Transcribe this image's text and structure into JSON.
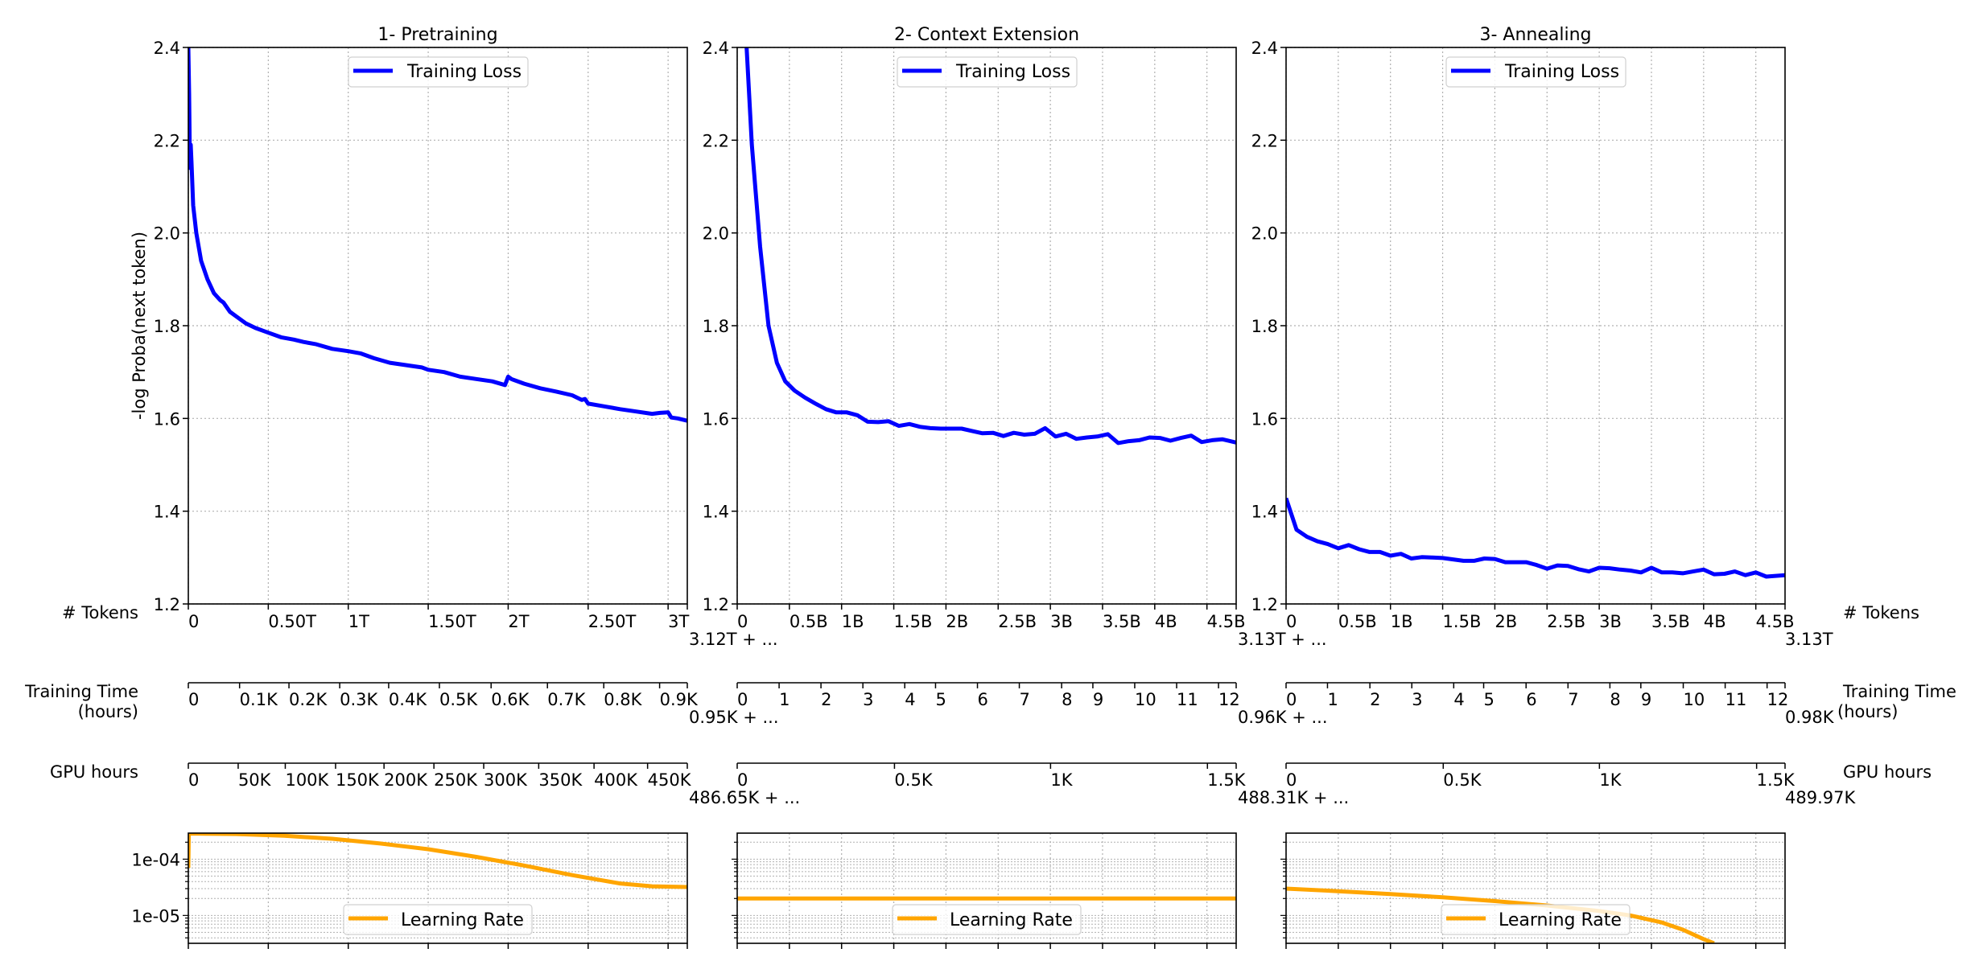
{
  "figure": {
    "row_labels_left": {
      "tokens": "# Tokens",
      "training_time_line1": "Training Time",
      "training_time_line2": "(hours)",
      "gpu_hours": "GPU hours"
    },
    "row_labels_right": {
      "tokens": "# Tokens",
      "training_time_line1": "Training Time",
      "training_time_line2": "(hours)",
      "gpu_hours": "GPU hours"
    },
    "colors": {
      "loss": "#0000ff",
      "lr": "#ffa500",
      "grid": "#b0b0b0"
    }
  },
  "chart_data": [
    {
      "type": "line",
      "panel": 1,
      "title": "1- Pretraining",
      "ylabel": "-log Proba(next token)",
      "ylim": [
        1.2,
        2.4
      ],
      "yticks": [
        1.2,
        1.4,
        1.6,
        1.8,
        2.0,
        2.2,
        2.4
      ],
      "ytick_labels": [
        "1.2",
        "1.4",
        "1.6",
        "1.8",
        "2.0",
        "2.2",
        "2.4"
      ],
      "grid": true,
      "legend": {
        "label": "Training Loss",
        "position": "upper-center"
      },
      "x_unit": "T tokens",
      "xlim": [
        0,
        3.12
      ],
      "series": [
        {
          "name": "Training Loss",
          "x": [
            0,
            0.005,
            0.01,
            0.015,
            0.02,
            0.03,
            0.05,
            0.08,
            0.12,
            0.16,
            0.2,
            0.22,
            0.26,
            0.3,
            0.36,
            0.42,
            0.5,
            0.58,
            0.66,
            0.72,
            0.8,
            0.9,
            1.0,
            1.08,
            1.16,
            1.26,
            1.36,
            1.46,
            1.5,
            1.6,
            1.7,
            1.8,
            1.9,
            1.98,
            2.0,
            2.02,
            2.1,
            2.2,
            2.3,
            2.4,
            2.46,
            2.48,
            2.5,
            2.6,
            2.7,
            2.8,
            2.9,
            2.95,
            3.0,
            3.02,
            3.06,
            3.12
          ],
          "y": [
            2.4,
            2.3,
            2.14,
            2.19,
            2.15,
            2.06,
            2.0,
            1.94,
            1.9,
            1.87,
            1.855,
            1.85,
            1.83,
            1.82,
            1.805,
            1.795,
            1.785,
            1.775,
            1.77,
            1.765,
            1.76,
            1.75,
            1.745,
            1.74,
            1.73,
            1.72,
            1.715,
            1.71,
            1.705,
            1.7,
            1.69,
            1.685,
            1.68,
            1.672,
            1.69,
            1.685,
            1.675,
            1.665,
            1.658,
            1.65,
            1.64,
            1.642,
            1.632,
            1.626,
            1.62,
            1.615,
            1.61,
            1.612,
            1.613,
            1.602,
            1.6,
            1.595
          ]
        }
      ],
      "x_axes": {
        "tokens": {
          "ticks": [
            0,
            0.5,
            1,
            1.5,
            2,
            2.5,
            3
          ],
          "labels": [
            "0",
            "0.50T",
            "1T",
            "1.50T",
            "2T",
            "2.50T",
            "3T"
          ],
          "offset": ""
        },
        "training_time": {
          "at": [
            0,
            0.1027,
            0.2017,
            0.3034,
            0.4015,
            0.5032,
            0.6068,
            0.7197,
            0.8326,
            0.9445
          ],
          "labels": [
            "0",
            "0.1K",
            "0.2K",
            "0.3K",
            "0.4K",
            "0.5K",
            "0.6K",
            "0.7K",
            "0.8K",
            "0.9K"
          ],
          "offset": ""
        },
        "gpu_hours": {
          "at": [
            0,
            0.0999,
            0.1943,
            0.2951,
            0.3922,
            0.4922,
            0.592,
            0.7022,
            0.8131,
            0.9204
          ],
          "labels": [
            "0",
            "50K",
            "100K",
            "150K",
            "200K",
            "250K",
            "300K",
            "350K",
            "400K",
            "450K"
          ],
          "offset": ""
        }
      },
      "lr": {
        "legend": "Learning Rate",
        "yscale": "log",
        "ylim": [
          3.2e-06,
          0.00029
        ],
        "ytick_labels": [
          "1e-05",
          "1e-04"
        ],
        "yticks": [
          1e-05,
          0.0001
        ],
        "x": [
          0,
          0.003,
          0.006,
          0.3,
          0.6,
          0.9,
          1.2,
          1.5,
          1.8,
          2.1,
          2.4,
          2.7,
          2.9,
          3.12
        ],
        "y": [
          7e-05,
          0.00028,
          0.000285,
          0.00028,
          0.00026,
          0.00023,
          0.00019,
          0.00015,
          0.00011,
          7.7e-05,
          5.2e-05,
          3.7e-05,
          3.3e-05,
          3.2e-05
        ]
      }
    },
    {
      "type": "line",
      "panel": 2,
      "title": "2- Context Extension",
      "ylim": [
        1.2,
        2.4
      ],
      "yticks": [
        1.2,
        1.4,
        1.6,
        1.8,
        2.0,
        2.2,
        2.4
      ],
      "ytick_labels": [
        "1.2",
        "1.4",
        "1.6",
        "1.8",
        "2.0",
        "2.2",
        "2.4"
      ],
      "grid": true,
      "legend": {
        "label": "Training Loss",
        "position": "upper-center"
      },
      "x_unit": "B tokens",
      "xlim": [
        0,
        4.78
      ],
      "series": [
        {
          "name": "Training Loss",
          "x": [
            0.09,
            0.14,
            0.22,
            0.3,
            0.38,
            0.46,
            0.55,
            0.65,
            0.75,
            0.85,
            0.95,
            1.05,
            1.15,
            1.25,
            1.35,
            1.45,
            1.55,
            1.65,
            1.75,
            1.85,
            1.95,
            2.05,
            2.15,
            2.25,
            2.35,
            2.45,
            2.55,
            2.65,
            2.75,
            2.85,
            2.95,
            3.05,
            3.15,
            3.25,
            3.35,
            3.45,
            3.55,
            3.65,
            3.75,
            3.85,
            3.95,
            4.05,
            4.15,
            4.25,
            4.35,
            4.45,
            4.55,
            4.65,
            4.78
          ],
          "y": [
            2.4,
            2.19,
            1.97,
            1.8,
            1.72,
            1.68,
            1.66,
            1.645,
            1.632,
            1.62,
            1.613,
            1.613,
            1.607,
            1.593,
            1.592,
            1.594,
            1.584,
            1.588,
            1.582,
            1.579,
            1.578,
            1.578,
            1.578,
            1.573,
            1.568,
            1.569,
            1.562,
            1.569,
            1.565,
            1.567,
            1.579,
            1.561,
            1.567,
            1.556,
            1.559,
            1.561,
            1.566,
            1.547,
            1.551,
            1.553,
            1.559,
            1.558,
            1.552,
            1.558,
            1.563,
            1.549,
            1.553,
            1.555,
            1.548
          ]
        }
      ],
      "x_axes": {
        "tokens": {
          "ticks": [
            0,
            0.5,
            1,
            1.5,
            2,
            2.5,
            3,
            3.5,
            4,
            4.5
          ],
          "labels": [
            "0",
            "0.5B",
            "1B",
            "1.5B",
            "2B",
            "2.5B",
            "3B",
            "3.5B",
            "4B",
            "4.5B"
          ],
          "offset": "3.12T + ..."
        },
        "training_time": {
          "at": [
            0,
            0.084,
            0.1679,
            0.2519,
            0.3358,
            0.3975,
            0.4815,
            0.5654,
            0.6502,
            0.7128,
            0.7967,
            0.8807,
            0.9646
          ],
          "labels": [
            "0",
            "1",
            "2",
            "3",
            "4",
            "5",
            "6",
            "7",
            "8",
            "9",
            "10",
            "11",
            "12"
          ],
          "offset": "0.95K + ..."
        },
        "gpu_hours": {
          "at": [
            0,
            0.3152,
            0.628,
            0.9424
          ],
          "labels": [
            "0",
            "0.5K",
            "1K",
            "1.5K"
          ],
          "offset": "486.65K + ..."
        }
      },
      "lr": {
        "legend": "Learning Rate",
        "yscale": "log",
        "ylim": [
          3.2e-06,
          0.00029
        ],
        "x": [
          0,
          4.78
        ],
        "y": [
          2e-05,
          2e-05
        ]
      }
    },
    {
      "type": "line",
      "panel": 3,
      "title": "3- Annealing",
      "ylim": [
        1.2,
        2.4
      ],
      "yticks": [
        1.2,
        1.4,
        1.6,
        1.8,
        2.0,
        2.2,
        2.4
      ],
      "ytick_labels": [
        "1.2",
        "1.4",
        "1.6",
        "1.8",
        "2.0",
        "2.2",
        "2.4"
      ],
      "grid": true,
      "legend": {
        "label": "Training Loss",
        "position": "upper-center"
      },
      "x_unit": "B tokens",
      "xlim": [
        0,
        4.78
      ],
      "series": [
        {
          "name": "Training Loss",
          "x": [
            0,
            0.1,
            0.2,
            0.3,
            0.4,
            0.5,
            0.6,
            0.7,
            0.8,
            0.9,
            1.0,
            1.1,
            1.2,
            1.3,
            1.4,
            1.5,
            1.6,
            1.7,
            1.8,
            1.9,
            2.0,
            2.1,
            2.2,
            2.3,
            2.4,
            2.5,
            2.6,
            2.7,
            2.8,
            2.9,
            3.0,
            3.1,
            3.2,
            3.3,
            3.4,
            3.5,
            3.6,
            3.7,
            3.8,
            3.9,
            4.0,
            4.1,
            4.2,
            4.3,
            4.4,
            4.5,
            4.6,
            4.78
          ],
          "y": [
            1.428,
            1.36,
            1.345,
            1.335,
            1.329,
            1.32,
            1.327,
            1.318,
            1.312,
            1.312,
            1.304,
            1.308,
            1.298,
            1.301,
            1.3,
            1.299,
            1.296,
            1.293,
            1.293,
            1.298,
            1.297,
            1.29,
            1.29,
            1.29,
            1.284,
            1.276,
            1.283,
            1.282,
            1.275,
            1.27,
            1.278,
            1.277,
            1.274,
            1.272,
            1.268,
            1.278,
            1.268,
            1.268,
            1.266,
            1.27,
            1.274,
            1.264,
            1.265,
            1.27,
            1.262,
            1.268,
            1.259,
            1.262
          ]
        }
      ],
      "x_axes": {
        "tokens": {
          "ticks": [
            0,
            0.5,
            1,
            1.5,
            2,
            2.5,
            3,
            3.5,
            4,
            4.5
          ],
          "labels": [
            "0",
            "0.5B",
            "1B",
            "1.5B",
            "2B",
            "2.5B",
            "3B",
            "3.5B",
            "4B",
            "4.5B"
          ],
          "offset": "3.13T + ...",
          "end_label": "3.13T"
        },
        "training_time": {
          "at": [
            0,
            0.083,
            0.168,
            0.252,
            0.336,
            0.396,
            0.481,
            0.565,
            0.649,
            0.711,
            0.796,
            0.88,
            0.964
          ],
          "labels": [
            "0",
            "1",
            "2",
            "3",
            "4",
            "5",
            "6",
            "7",
            "8",
            "9",
            "10",
            "11",
            "12"
          ],
          "offset": "0.96K + ...",
          "end_label": "0.98K"
        },
        "gpu_hours": {
          "at": [
            0,
            0.315,
            0.628,
            0.943
          ],
          "labels": [
            "0",
            "0.5K",
            "1K",
            "1.5K"
          ],
          "offset": "488.31K + ...",
          "end_label": "489.97K"
        }
      },
      "lr": {
        "legend": "Learning Rate",
        "yscale": "log",
        "ylim": [
          3.2e-06,
          0.00029
        ],
        "x": [
          0,
          0.5,
          1.0,
          1.5,
          2.0,
          2.5,
          3.0,
          3.3,
          3.6,
          3.8,
          4.0,
          4.1
        ],
        "y": [
          3e-05,
          2.7e-05,
          2.4e-05,
          2.1e-05,
          1.8e-05,
          1.5e-05,
          1.2e-05,
          1e-05,
          7.5e-06,
          5.6e-06,
          3.8e-06,
          3.2e-06
        ]
      }
    }
  ]
}
